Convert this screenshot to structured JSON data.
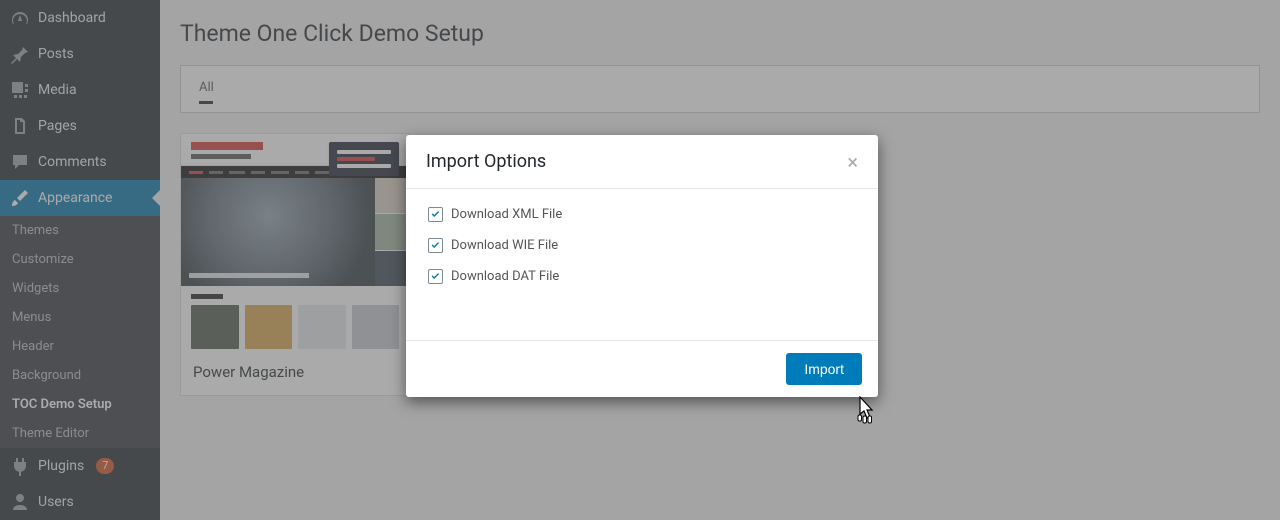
{
  "sidebar": {
    "items": [
      {
        "label": "Dashboard"
      },
      {
        "label": "Posts"
      },
      {
        "label": "Media"
      },
      {
        "label": "Pages"
      },
      {
        "label": "Comments"
      },
      {
        "label": "Appearance"
      },
      {
        "label": "Plugins",
        "badge": "7"
      },
      {
        "label": "Users"
      }
    ],
    "appearance_sub": [
      {
        "label": "Themes"
      },
      {
        "label": "Customize"
      },
      {
        "label": "Widgets"
      },
      {
        "label": "Menus"
      },
      {
        "label": "Header"
      },
      {
        "label": "Background"
      },
      {
        "label": "TOC Demo Setup"
      },
      {
        "label": "Theme Editor"
      }
    ]
  },
  "main": {
    "title": "Theme One Click Demo Setup",
    "tab_all": "All",
    "card_title": "Power Magazine"
  },
  "modal": {
    "title": "Import Options",
    "options": [
      {
        "label": "Download XML File"
      },
      {
        "label": "Download WIE File"
      },
      {
        "label": "Download DAT File"
      }
    ],
    "import_button": "Import"
  }
}
